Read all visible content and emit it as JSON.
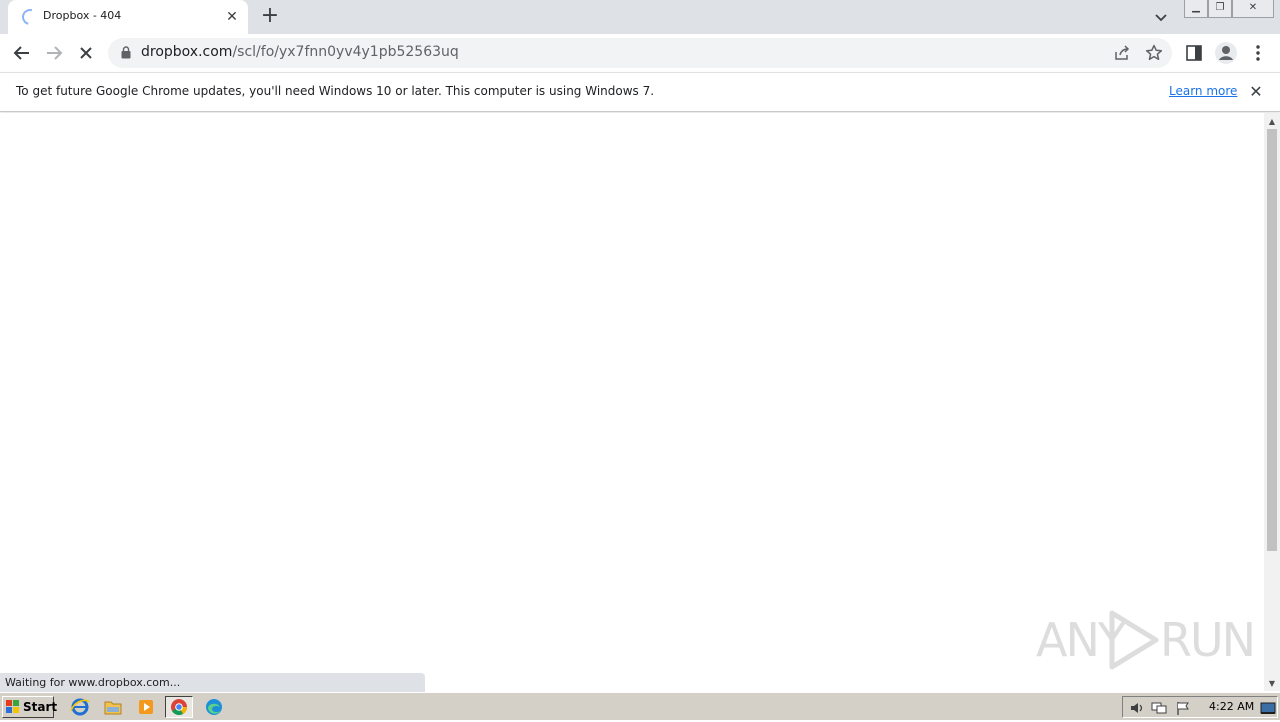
{
  "browser": {
    "tab": {
      "title": "Dropbox - 404"
    },
    "address_bar": {
      "host": "dropbox.com",
      "path": "/scl/fo/yx7fnn0yv4y1pb52563uq"
    },
    "infobar": {
      "message": "To get future Google Chrome updates, you'll need Windows 10 or later. This computer is using Windows 7.",
      "link": "Learn more"
    },
    "status": "Waiting for www.dropbox.com..."
  },
  "watermark": {
    "left": "ANY",
    "right": "RUN"
  },
  "taskbar": {
    "start_label": "Start",
    "apps": [
      "internet-explorer-icon",
      "file-explorer-icon",
      "media-player-icon",
      "chrome-icon",
      "edge-icon"
    ],
    "clock": "4:22 AM"
  },
  "colors": {
    "accent": "#1a73e8",
    "tabstrip": "#dee1e6",
    "taskbar": "#d4d0c8"
  }
}
